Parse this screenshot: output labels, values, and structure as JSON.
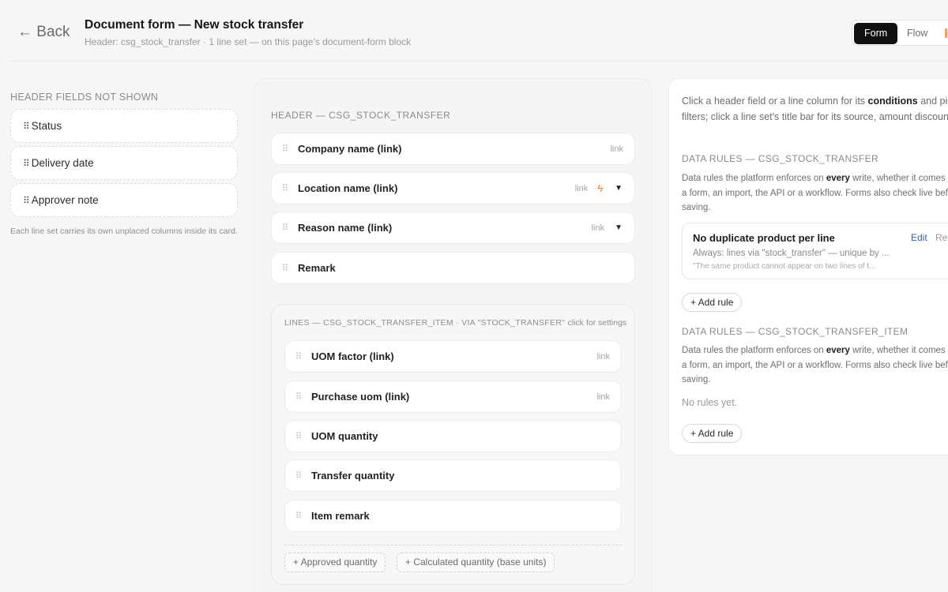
{
  "header": {
    "back_label": "← Back",
    "title": "Document form — New stock transfer",
    "subtitle": "Header: csg_stock_transfer · 1 line set — on this page's document-form block",
    "view_tabs": [
      "Form",
      "Flow"
    ]
  },
  "left": {
    "section_label": "HEADER FIELDS NOT SHOWN",
    "grip_glyph": "⠿",
    "items": [
      "Status",
      "Delivery date",
      "Approver note"
    ],
    "note": "Each line set carries its own unplaced columns inside its card."
  },
  "middle": {
    "header_label": "HEADER — CSG_STOCK_TRANSFER",
    "drag_glyph": "⠿",
    "header_fields": [
      {
        "name": "Company name (link)",
        "tag": "link"
      },
      {
        "name": "Location name (link)",
        "tag": "link",
        "has_trigger": true,
        "has_filter": true
      },
      {
        "name": "Reason name (link)",
        "tag": "link",
        "has_filter": true
      },
      {
        "name": "Remark",
        "tag": ""
      }
    ],
    "trigger_glyph": "ϟ",
    "filter_glyph": "▼",
    "lines": {
      "title": "LINES — CSG_STOCK_TRANSFER_ITEM · VIA \"STOCK_TRANSFER\"",
      "settings_hint": "click for settings",
      "fields": [
        {
          "name": "UOM factor (link)",
          "tag": "link"
        },
        {
          "name": "Purchase uom (link)",
          "tag": "link"
        },
        {
          "name": "UOM quantity",
          "tag": ""
        },
        {
          "name": "Transfer quantity",
          "tag": ""
        },
        {
          "name": "Item remark",
          "tag": ""
        }
      ],
      "add_columns": [
        "+ Approved quantity",
        "+ Calculated quantity (base units)"
      ]
    }
  },
  "right": {
    "intro_pre": "Click a header field or a line column for its ",
    "intro_bold": "conditions",
    "intro_post": " and picker filters; click a line set's title bar for its source, amount discounts.",
    "sections": [
      {
        "label": "DATA RULES — CSG_STOCK_TRANSFER",
        "desc_pre": "Data rules the platform enforces on ",
        "desc_bold": "every",
        "desc_post": " write, whether it comes from a form, an import, the API or a workflow. Forms also check live before saving.",
        "rule": {
          "title": "No duplicate product per line",
          "line1": "Always: lines via \"stock_transfer\" — unique by ...",
          "line2": "\"The same product cannot appear on two lines of t...",
          "edit": "Edit",
          "remove": "Remove"
        },
        "add_rule": "+ Add rule"
      },
      {
        "label": "DATA RULES — CSG_STOCK_TRANSFER_ITEM",
        "desc_pre": "Data rules the platform enforces on ",
        "desc_bold": "every",
        "desc_post": " write, whether it comes from a form, an import, the API or a workflow. Forms also check live before saving.",
        "empty": "No rules yet.",
        "add_rule": "+ Add rule"
      }
    ]
  }
}
